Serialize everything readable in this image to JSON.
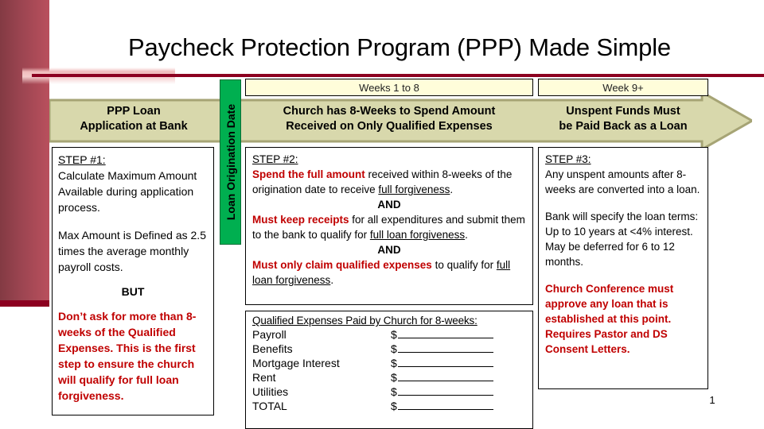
{
  "slide": {
    "title": "Paycheck Protection Program (PPP) Made Simple",
    "page_number": "1",
    "colors": {
      "accent_bar": "#8c0020",
      "arrow_fill": "#d8d8ac",
      "arrow_outline": "#a6a475",
      "period_box_fill": "#fffdda",
      "marker_green": "#00af50",
      "emphasis_red": "#c00000"
    }
  },
  "timeline": {
    "periods": [
      {
        "label": "Weeks 1 to 8"
      },
      {
        "label": "Week 9+"
      }
    ],
    "marker": {
      "label": "Loan Origination Date",
      "color": "#00af50"
    }
  },
  "phases": [
    {
      "label_line1": "PPP Loan",
      "label_line2": "Application at Bank"
    },
    {
      "label_line1": "Church has 8-Weeks to Spend Amount",
      "label_line2": "Received on Only Qualified Expenses"
    },
    {
      "label_line1": "Unspent Funds Must",
      "label_line2": "be Paid Back as a Loan"
    }
  ],
  "step1": {
    "heading": "STEP #1:",
    "para1": "Calculate Maximum Amount Available during application process.",
    "para2": "Max Amount is Defined as 2.5 times the average monthly payroll costs.",
    "but": "BUT",
    "warning": "Don’t ask for more than 8-weeks of the Qualified Expenses. This is the first step to ensure the church will qualify for full loan forgiveness."
  },
  "step2": {
    "heading": "STEP #2:",
    "line1_red": "Spend the full amount",
    "line1_rest_a": " received within 8-weeks of the origination date to receive ",
    "line1_underline": "full forgiveness",
    "line1_rest_b": ".",
    "and1": "AND",
    "line2_red": "Must keep receipts",
    "line2_rest_a": " for all expenditures and submit them to the bank to qualify for ",
    "line2_underline": "full loan forgiveness",
    "line2_rest_b": ".",
    "and2": "AND",
    "line3_red": "Must only claim qualified expenses",
    "line3_rest_a": " to qualify for ",
    "line3_underline": "full loan forgiveness",
    "line3_rest_b": "."
  },
  "expenses": {
    "title": "Qualified Expenses Paid by Church for 8-weeks:",
    "currency_symbol": "$",
    "rows": [
      {
        "name": "Payroll",
        "amount": ""
      },
      {
        "name": "Benefits",
        "amount": ""
      },
      {
        "name": "Mortgage Interest",
        "amount": ""
      },
      {
        "name": "Rent",
        "amount": ""
      },
      {
        "name": "Utilities",
        "amount": ""
      }
    ],
    "total": {
      "name": "TOTAL",
      "amount": ""
    }
  },
  "step3": {
    "heading": "STEP #3:",
    "para1": "Any unspent amounts after 8-weeks are converted into a loan.",
    "para2": "Bank will specify the loan terms:  Up to 10 years at <4% interest.  May be deferred for 6 to 12 months.",
    "warning": "Church Conference must approve any loan that is established at this point. Requires Pastor and DS Consent Letters."
  }
}
